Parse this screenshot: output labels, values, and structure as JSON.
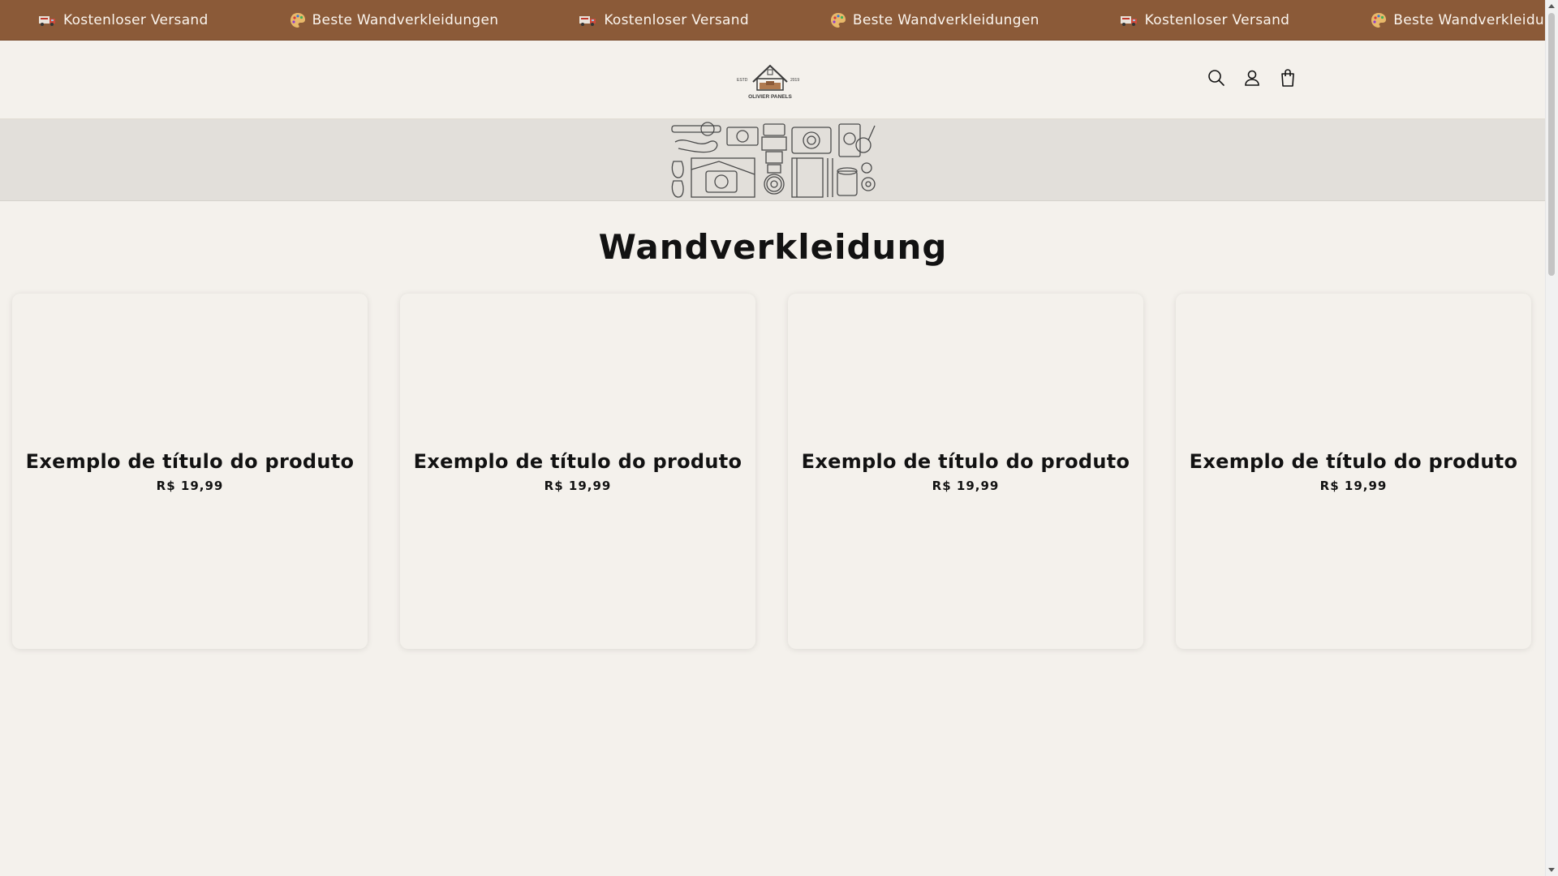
{
  "announcement": {
    "items": [
      {
        "icon": "truck-icon",
        "text": "Kostenloser Versand"
      },
      {
        "icon": "palette-icon",
        "text": "Beste Wandverkleidungen"
      },
      {
        "icon": "truck-icon",
        "text": "Kostenloser Versand"
      },
      {
        "icon": "palette-icon",
        "text": "Beste Wandverkleidungen"
      },
      {
        "icon": "truck-icon",
        "text": "Kostenloser Versand"
      },
      {
        "icon": "palette-icon",
        "text": "Beste Wandverkleidungen"
      }
    ]
  },
  "header": {
    "logo": {
      "estd": "ESTD",
      "year": "2019",
      "name": "OLIVIER PANELS"
    },
    "icons": [
      "search-icon",
      "account-icon",
      "cart-icon"
    ]
  },
  "collection": {
    "title": "Wandverkleidung"
  },
  "products": [
    {
      "title": "Exemplo de título do produto",
      "price": "R$ 19,99"
    },
    {
      "title": "Exemplo de título do produto",
      "price": "R$ 19,99"
    },
    {
      "title": "Exemplo de título do produto",
      "price": "R$ 19,99"
    },
    {
      "title": "Exemplo de título do produto",
      "price": "R$ 19,99"
    }
  ],
  "colors": {
    "announcement_bg": "#8b5a38",
    "page_bg": "#f4f1ec",
    "banner_bg": "#e2dfda",
    "text": "#121212"
  }
}
